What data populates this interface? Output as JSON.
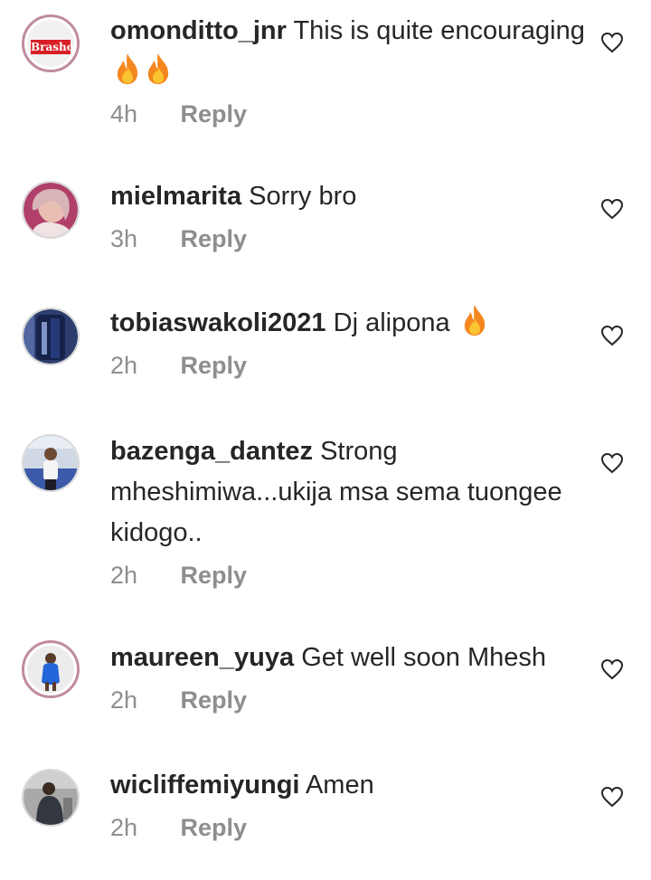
{
  "comments": [
    {
      "username": "omonditto_jnr",
      "text": "This is quite encouraging",
      "emojis": [
        "fire-emoji",
        "fire-emoji"
      ],
      "time": "4h",
      "reply": "Reply",
      "avatar_label": "Brasho"
    },
    {
      "username": "mielmarita",
      "text": "Sorry bro",
      "emojis": [],
      "time": "3h",
      "reply": "Reply"
    },
    {
      "username": "tobiaswakoli2021",
      "text": "Dj alipona",
      "emojis": [
        "fire-emoji"
      ],
      "time": "2h",
      "reply": "Reply"
    },
    {
      "username": "bazenga_dantez",
      "text": "Strong mheshimiwa...ukija msa sema tuongee kidogo..",
      "emojis": [],
      "time": "2h",
      "reply": "Reply"
    },
    {
      "username": "maureen_yuya",
      "text": "Get well soon Mhesh",
      "emojis": [],
      "time": "2h",
      "reply": "Reply"
    },
    {
      "username": "wicliffemiyungi",
      "text": "Amen",
      "emojis": [],
      "time": "2h",
      "reply": "Reply"
    }
  ],
  "colors": {
    "text": "#262626",
    "meta": "#8e8e8e",
    "fire_outer": "#f4871f",
    "fire_inner": "#fbc531"
  }
}
